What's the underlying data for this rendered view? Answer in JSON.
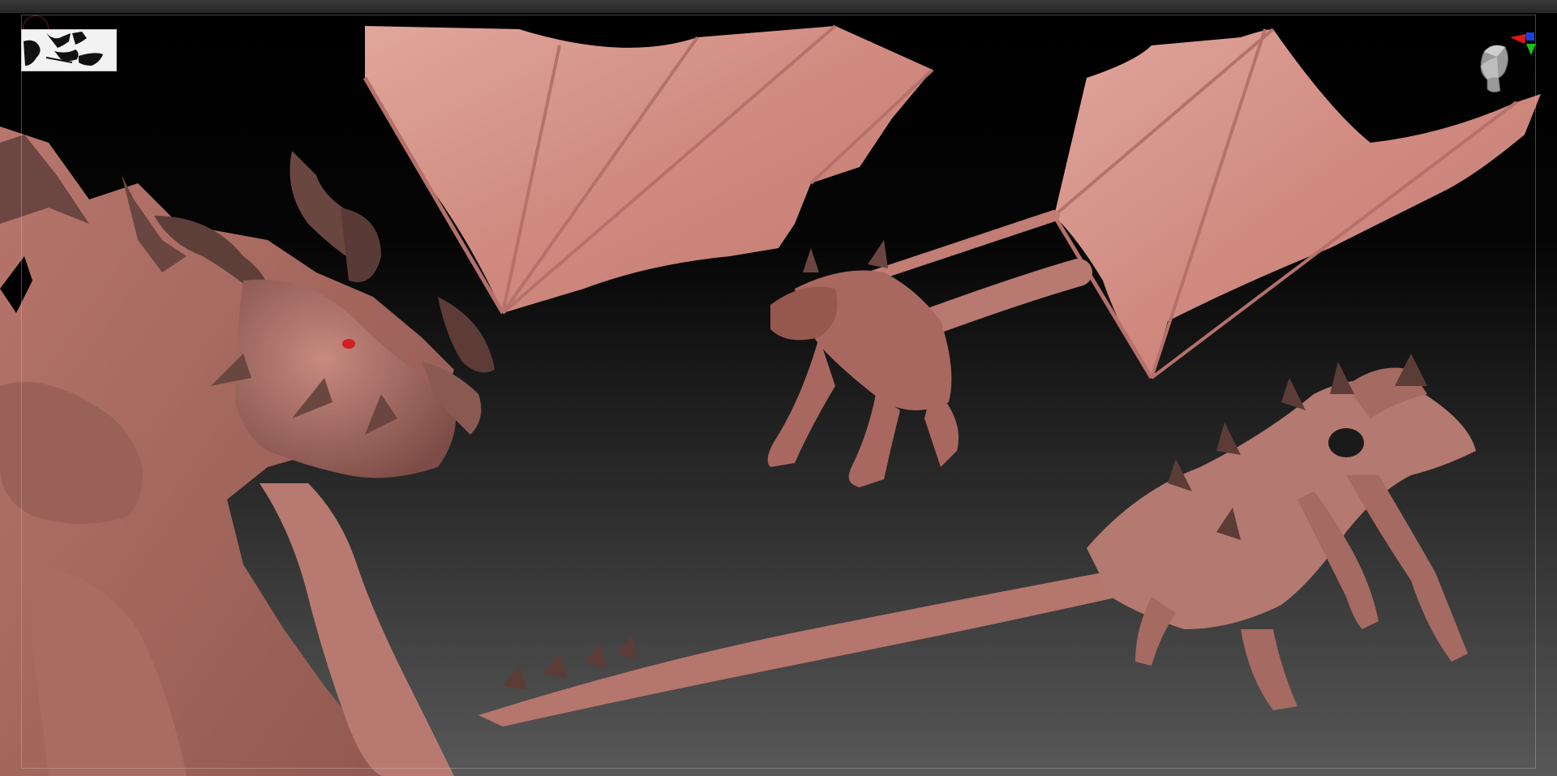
{
  "app": {
    "name": ""
  },
  "colors": {
    "background_top": "#000000",
    "background_bottom": "#585858",
    "skin": "#c47e74",
    "skin_dark": "#7a4a45",
    "horn": "#6a4a44",
    "wing_membrane": "#d8938a",
    "eye": "#d21e1e",
    "axis_x": "#e01818",
    "axis_y": "#18c018",
    "axis_z": "#1840e0"
  },
  "icons": {
    "navigator": "document-thumbnail-icon",
    "orientation": "orientation-head-icon",
    "axis": "xyz-axis-icon"
  }
}
